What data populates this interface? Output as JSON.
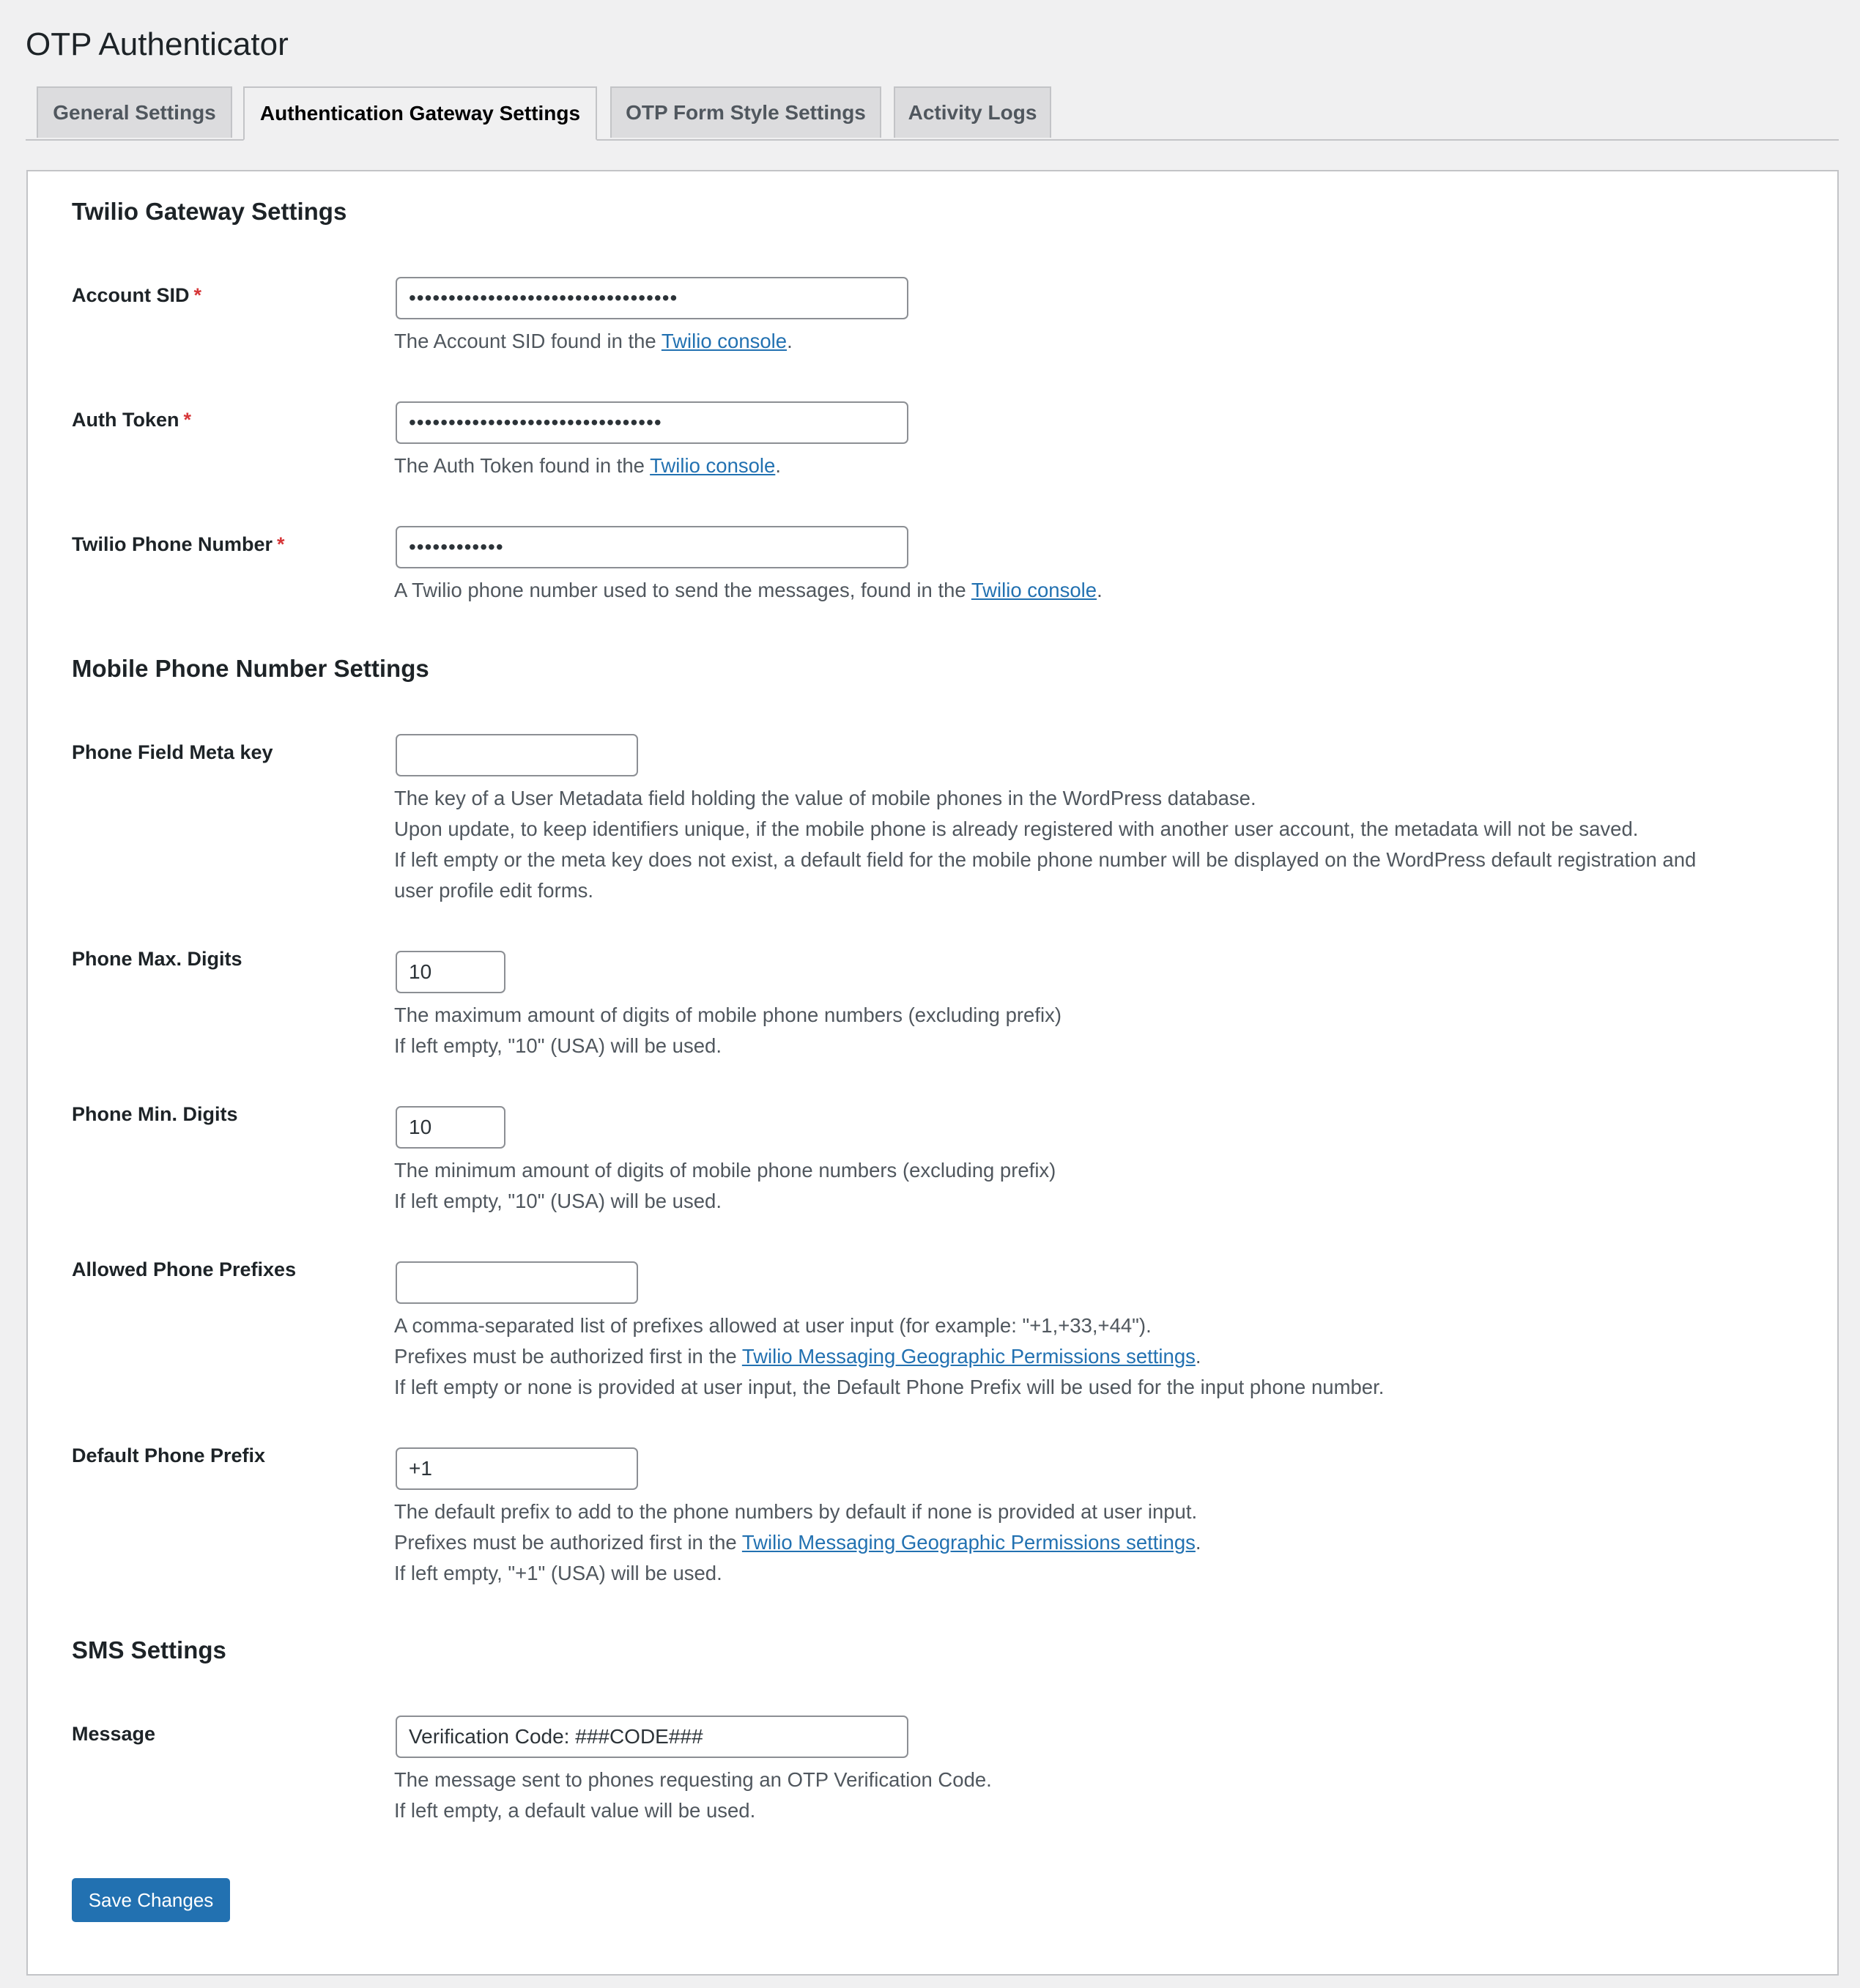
{
  "page": {
    "title": "OTP Authenticator"
  },
  "tabs": [
    {
      "label": "General Settings",
      "active": false
    },
    {
      "label": "Authentication Gateway Settings",
      "active": true
    },
    {
      "label": "OTP Form Style Settings",
      "active": false
    },
    {
      "label": "Activity Logs",
      "active": false
    }
  ],
  "twilio": {
    "heading": "Twilio Gateway Settings",
    "account_sid": {
      "label": "Account SID",
      "required_mark": "*",
      "value": "••••••••••••••••••••••••••••••••••",
      "hint_before": "The Account SID found in the ",
      "hint_link": "Twilio console",
      "hint_after": "."
    },
    "auth_token": {
      "label": "Auth Token",
      "required_mark": "*",
      "value": "••••••••••••••••••••••••••••••••",
      "hint_before": "The Auth Token found in the ",
      "hint_link": "Twilio console",
      "hint_after": "."
    },
    "phone_number": {
      "label": "Twilio Phone Number",
      "required_mark": "*",
      "value": "••••••••••••",
      "hint_before": "A Twilio phone number used to send the messages, found in the ",
      "hint_link": "Twilio console",
      "hint_after": "."
    }
  },
  "mobile": {
    "heading": "Mobile Phone Number Settings",
    "meta_key": {
      "label": "Phone Field Meta key",
      "value": "",
      "hint_lines": [
        "The key of a User Metadata field holding the value of mobile phones in the WordPress database.",
        "Upon update, to keep identifiers unique, if the mobile phone is already registered with another user account, the metadata will not be saved.",
        "If left empty or the meta key does not exist, a default field for the mobile phone number will be displayed on the WordPress default registration and",
        "user profile edit forms."
      ]
    },
    "max_digits": {
      "label": "Phone Max. Digits",
      "value": "10",
      "hint_lines": [
        "The maximum amount of digits of mobile phone numbers (excluding prefix)",
        "If left empty, \"10\" (USA) will be used."
      ]
    },
    "min_digits": {
      "label": "Phone Min. Digits",
      "value": "10",
      "hint_lines": [
        "The minimum amount of digits of mobile phone numbers (excluding prefix)",
        "If left empty, \"10\" (USA) will be used."
      ]
    },
    "allowed_prefixes": {
      "label": "Allowed Phone Prefixes",
      "value": "",
      "hint_line1": "A comma-separated list of prefixes allowed at user input (for example: \"+1,+33,+44\").",
      "hint_line2_before": "Prefixes must be authorized first in the ",
      "hint_line2_link": "Twilio Messaging Geographic Permissions settings",
      "hint_line2_after": ".",
      "hint_line3": "If left empty or none is provided at user input, the Default Phone Prefix will be used for the input phone number."
    },
    "default_prefix": {
      "label": "Default Phone Prefix",
      "value": "+1",
      "hint_line1": "The default prefix to add to the phone numbers by default if none is provided at user input.",
      "hint_line2_before": "Prefixes must be authorized first in the ",
      "hint_line2_link": "Twilio Messaging Geographic Permissions settings",
      "hint_line2_after": ".",
      "hint_line3": "If left empty, \"+1\" (USA) will be used."
    }
  },
  "sms": {
    "heading": "SMS Settings",
    "message": {
      "label": "Message",
      "value": "Verification Code: ###CODE###",
      "hint_lines": [
        "The message sent to phones requesting an OTP Verification Code.",
        "If left empty, a default value will be used."
      ]
    }
  },
  "actions": {
    "save_label": "Save Changes"
  },
  "colors": {
    "primary": "#2271b1",
    "required": "#d63638",
    "link": "#2271b1",
    "background": "#f0f0f1"
  }
}
